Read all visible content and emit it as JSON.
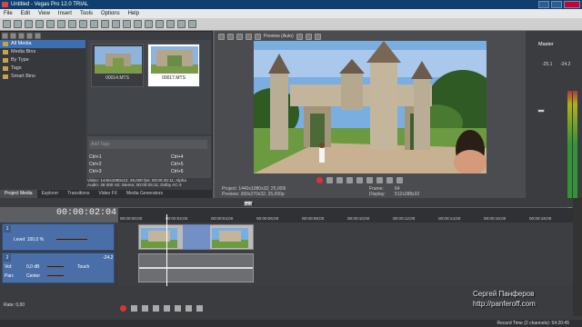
{
  "window": {
    "title": "Untitled - Vegas Pro 12.0 TRIAL"
  },
  "menu": [
    "File",
    "Edit",
    "View",
    "Insert",
    "Tools",
    "Options",
    "Help"
  ],
  "explorer": {
    "tree": [
      "All Media",
      "Media Bins",
      "By Type",
      "Tags",
      "Smart Bins"
    ],
    "thumbs": [
      {
        "label": "00014.MTS"
      },
      {
        "label": "00017.MTS"
      }
    ],
    "tags_placeholder": "Add Tags",
    "shortcuts": [
      "Ctrl+1",
      "Ctrl+2",
      "Ctrl+3",
      "Ctrl+4",
      "Ctrl+5",
      "Ctrl+6"
    ],
    "video_info": "Video: 1440x1080x12; 25,000 fps; 00:00:25:11; Alpha",
    "audio_info": "Audio: 48 000 Hz; Stereo; 00:00:25:11; Dolby AC-3"
  },
  "tabs": [
    "Project Media",
    "Explorer",
    "Transitions",
    "Video FX",
    "Media Generators"
  ],
  "preview": {
    "mode": "Preview (Auto)",
    "project": "Project:  1440x1080x32; 25,000i",
    "preview_res": "Preview:  360x270x32; 25,000p",
    "frame_label": "Frame:",
    "frame": "64",
    "display_label": "Display:",
    "display": "512x288x32"
  },
  "master": {
    "title": "Master",
    "left_db": "-25.1",
    "right_db": "-24.2"
  },
  "timeline": {
    "timecode": "00:00:02:04",
    "scrub_marker": "+4.00",
    "ruler": [
      "00:00:00;00",
      "00:00:02;00",
      "00:00:04;00",
      "00:00:06;00",
      "00:00:08;00",
      "00:00:10;00",
      "00:00:12;00",
      "00:00:14;00",
      "00:00:16;00",
      "00:00:18;00"
    ]
  },
  "track1": {
    "num": "1",
    "level": "Level: 100,0 %"
  },
  "track2": {
    "num": "2",
    "vol": "Vol:",
    "vol_val": "0,0 dB",
    "mode": "Touch",
    "pan": "Pan:",
    "pan_val": "Center",
    "db": "-24.2"
  },
  "bottom": {
    "rate": "Rate: 0,00",
    "watermark1": "Сергей Панферов",
    "watermark2": "http://panferoff.com",
    "status": "Record Time (2 channels): 54:20:45"
  }
}
